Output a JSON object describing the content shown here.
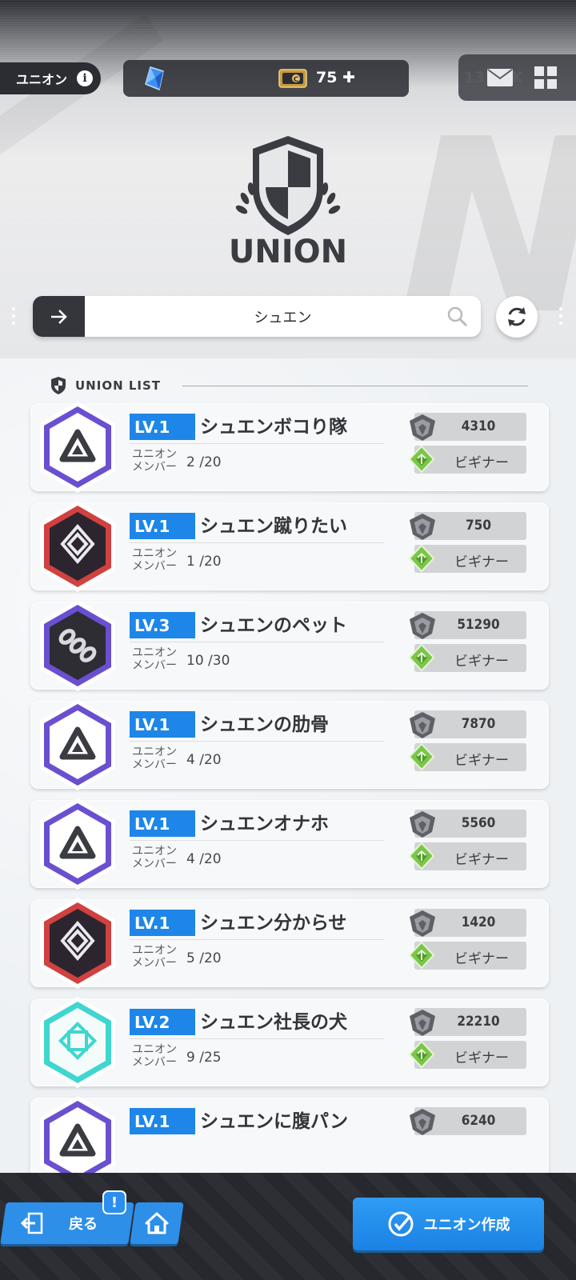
{
  "header": {
    "section_label": "ユニオン",
    "gems": "75",
    "credits": "1317 K",
    "logo_text": "UNION"
  },
  "search": {
    "value": "シュエン"
  },
  "list": {
    "title": "UNION LIST",
    "member_label_line1": "ユニオン",
    "member_label_line2": "メンバー",
    "unions": [
      {
        "level": "LV.1",
        "name": "シュエンボコり隊",
        "members": "2 /20",
        "points": "4310",
        "rank": "ビギナー",
        "emblem": "triangle-emblem-purple"
      },
      {
        "level": "LV.1",
        "name": "シュエン蹴りたい",
        "members": "1 /20",
        "points": "750",
        "rank": "ビギナー",
        "emblem": "diamond-emblem-red"
      },
      {
        "level": "LV.3",
        "name": "シュエンのペット",
        "members": "10 /30",
        "points": "51290",
        "rank": "ビギナー",
        "emblem": "chain-emblem-purple"
      },
      {
        "level": "LV.1",
        "name": "シュエンの肋骨",
        "members": "4 /20",
        "points": "7870",
        "rank": "ビギナー",
        "emblem": "triangle-emblem-purple"
      },
      {
        "level": "LV.1",
        "name": "シュエンオナホ",
        "members": "4 /20",
        "points": "5560",
        "rank": "ビギナー",
        "emblem": "triangle-emblem-purple"
      },
      {
        "level": "LV.1",
        "name": "シュエン分からせ",
        "members": "5 /20",
        "points": "1420",
        "rank": "ビギナー",
        "emblem": "diamond-emblem-red"
      },
      {
        "level": "LV.2",
        "name": "シュエン社長の犬",
        "members": "9 /25",
        "points": "22210",
        "rank": "ビギナー",
        "emblem": "knot-emblem-teal"
      },
      {
        "level": "LV.1",
        "name": "シュエンに腹パン",
        "members": "",
        "points": "6240",
        "rank": "",
        "emblem": "triangle-emblem-purple"
      }
    ]
  },
  "footer": {
    "back_label": "戻る",
    "notification_badge": "!",
    "create_label": "ユニオン作成"
  },
  "colors": {
    "accent_blue": "#1e86e8",
    "emblem_purple": "#6a4fd1",
    "emblem_red": "#d0413f",
    "emblem_teal": "#3fd6cf",
    "rank_green": "#7bc64a"
  }
}
